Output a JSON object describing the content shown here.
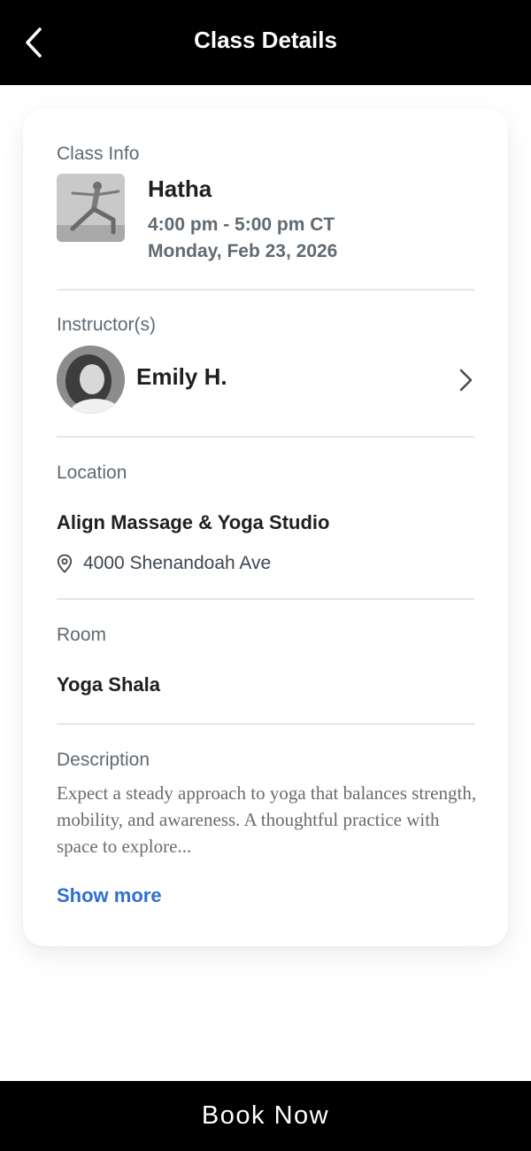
{
  "header": {
    "title": "Class Details",
    "back_icon": "chevron-left-icon"
  },
  "class_info": {
    "label": "Class Info",
    "name": "Hatha",
    "time": "4:00 pm - 5:00 pm CT",
    "date": "Monday, Feb 23, 2026"
  },
  "instructor": {
    "label": "Instructor(s)",
    "name": "Emily H."
  },
  "location": {
    "label": "Location",
    "name": "Align Massage & Yoga Studio",
    "address": "4000 Shenandoah Ave"
  },
  "room": {
    "label": "Room",
    "name": "Yoga Shala"
  },
  "description": {
    "label": "Description",
    "text": "Expect a steady approach to yoga that balances strength, mobility, and awareness. A thoughtful practice with space to explore...",
    "show_more": "Show more"
  },
  "footer": {
    "book_label": "Book Now"
  },
  "colors": {
    "header_bg": "#000000",
    "link": "#2f6fd1",
    "label_gray": "#5f6a72"
  }
}
